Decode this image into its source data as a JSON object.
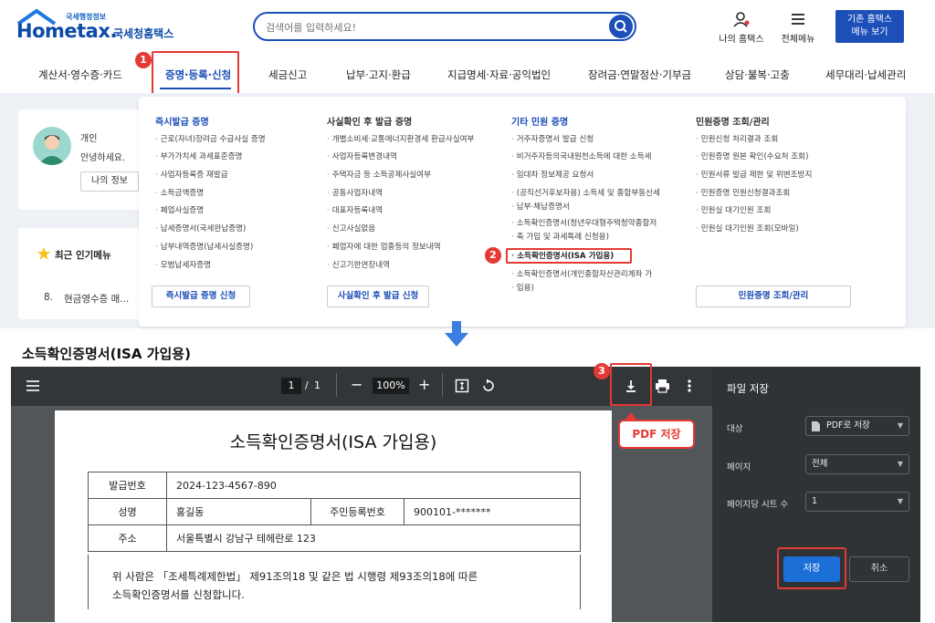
{
  "header": {
    "logo_tagline": "국세행정정보",
    "logo_main": "Hometax.",
    "logo_sub": "국세청홈택스",
    "search_placeholder": "검색어를 입력하세요!",
    "my_hometax": "나의 홈택스",
    "all_menu": "전체메뉴",
    "legacy_button": "기존 홈택스\n메뉴 보기"
  },
  "nav": {
    "items": [
      "계산서·영수증·카드",
      "증명·등록·신청",
      "세금신고",
      "납부·고지·환급",
      "지급명세·자료·공익법인",
      "장려금·연말정산·기부금",
      "상담·불복·고충",
      "세무대리·납세관리"
    ]
  },
  "profile": {
    "role": "개인",
    "greeting": "안녕하세요.",
    "my_info_button": "나의 정보"
  },
  "popular": {
    "title": "최근 인기메뉴",
    "item_num": "8.",
    "item_label": "현금영수증 매..."
  },
  "mega_menu": {
    "columns": [
      {
        "title": "즉시발급 증명",
        "items": [
          "근로(자녀)장려금 수급사실 증명",
          "부가가치세 과세표준증명",
          "사업자등록증 재발급",
          "소득금액증명",
          "폐업사실증명",
          "납세증명서(국세완납증명)",
          "납부내역증명(납세사실증명)",
          "모범납세자증명"
        ],
        "button": "즉시발급 증명 신청"
      },
      {
        "title": "사실확인 후 발급 증명",
        "items": [
          "개별소비세·교통에너지환경세 환급사실여부",
          "사업자등록변경내역",
          "주택자금 등 소득공제사실여부",
          "공동사업자내역",
          "대표자등록내역",
          "신고사실없음",
          "폐업자에 대한 업종등의 정보내역",
          "신고기한연장내역"
        ],
        "button": "사실확인 후 발급 신청"
      },
      {
        "title": "기타 민원 증명",
        "items": [
          "거주자증명서 발급 신청",
          "비거주자등의국내원천소득에 대한 소득세",
          "임대차 정보제공 요청서",
          "(공직선거후보자용) 소득세 및 종합부동산세",
          "납부·체납증명서",
          "소득확인증명서(청년우대형주택청약종합저",
          "축 가입 및 과세특례 신청용)",
          "소득확인증명서(ISA 가입용)",
          "소득확인증명서(개인종합자산관리계좌 가",
          "입용)"
        ]
      },
      {
        "title": "민원증명 조회/관리",
        "items": [
          "민원신청 처리결과 조회",
          "민원증명 원본 확인(수요처 조회)",
          "민원서류 발급 제한 및 위변조방지",
          "민원증명 민원신청결과조회",
          "민원실 대기인원 조회",
          "민원실 대기인원 조회(모바일)"
        ],
        "button": "민원증명 조회/관리"
      }
    ]
  },
  "steps": {
    "one": "1",
    "two": "2",
    "three": "3"
  },
  "section_title": "소득확인증명서(ISA 가입용)",
  "viewer": {
    "page_current": "1",
    "page_sep": "/",
    "page_total": "1",
    "zoom": "100%",
    "callout": "PDF 저장"
  },
  "document": {
    "title": "소득확인증명서(ISA 가입용)",
    "issue_no_label": "발급번호",
    "issue_no": "2024-123-4567-890",
    "name_label": "성명",
    "name": "홍길동",
    "rrn_label": "주민등록번호",
    "rrn": "900101-*******",
    "addr_label": "주소",
    "addr": "서울특별시 강남구 테헤란로 123",
    "body_line1": "위 사람은 「조세특례제한법」 제91조의18 및 같은 법 시행령 제93조의18에 따른",
    "body_line2": "소득확인증명서를 신청합니다."
  },
  "save_panel": {
    "title": "파일 저장",
    "dest_label": "대상",
    "dest_value": "PDF로 저장",
    "pages_label": "페이지",
    "pages_value": "전체",
    "sheets_label": "페이지당 시트 수",
    "sheets_value": "1",
    "save": "저장",
    "cancel": "취소"
  },
  "colors": {
    "brand": "#1d4fb8",
    "highlight": "#e53935"
  }
}
